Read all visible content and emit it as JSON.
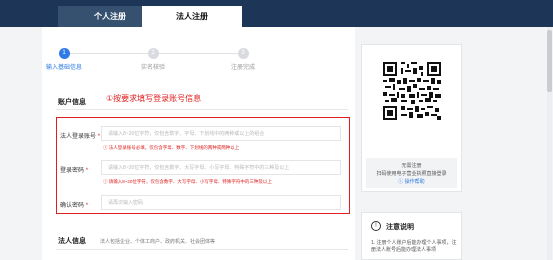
{
  "tabs": [
    {
      "label": "个人注册",
      "active": false
    },
    {
      "label": "法人注册",
      "active": true
    }
  ],
  "steps": [
    {
      "num": "1",
      "label": "输入基础信息"
    },
    {
      "num": "2",
      "label": "实名核验"
    },
    {
      "num": "3",
      "label": "注册完成"
    }
  ],
  "account_section": {
    "title": "账户信息",
    "annotation": "①按要求填写登录账号信息",
    "fields": [
      {
        "label": "法人登录账号",
        "required": "*",
        "placeholder": "请输入8~20位字符，仅包含数字、字母、下划线中的两种或以上的组合",
        "hint": "ⓘ 法人登录账号必填，仅包含字母、数字、下划线的两种或两种以上"
      },
      {
        "label": "登录密码",
        "required": "*",
        "placeholder": "请输入8~20位字符，仅包含数字、大写字母、小写字母、特殊字符中的三种及以上",
        "hint": "ⓘ 请输入8~20位字符，仅包含数字、大写字母、小写字母、特殊字符中的三种及以上"
      },
      {
        "label": "确认密码",
        "required": "*",
        "placeholder": "请再次输入密码",
        "hint": ""
      }
    ]
  },
  "legal_section": {
    "title": "法人信息",
    "subtitle": "法人包括企业、个体工商户、政府机关、社会团体等"
  },
  "qr_panel": {
    "line1": "无需注册",
    "line2": "扫码使用电子营业执照直接登录",
    "link": "ⓘ 操作帮助"
  },
  "notice": {
    "icon": "!",
    "title": "注意说明",
    "body": "1. 注册个人账户后能办理个人事项，注册法人账号后能办理法人事项"
  },
  "colors": {
    "topbar": "#1d3557",
    "accent": "#2f7be5",
    "alert": "#e02020"
  }
}
